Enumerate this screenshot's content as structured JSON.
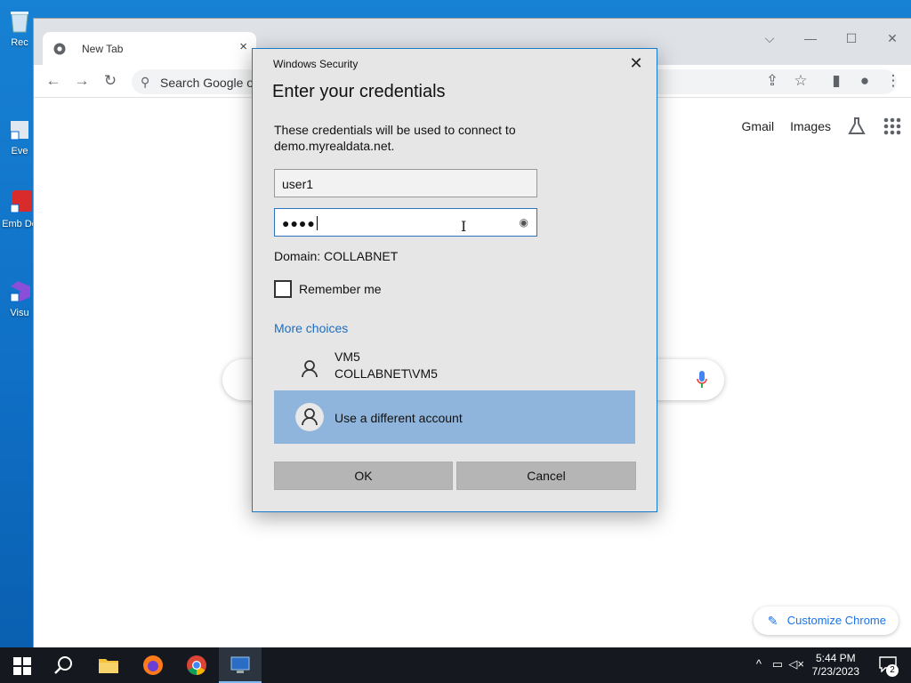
{
  "desktop": {
    "icons": [
      {
        "label": "Rec"
      },
      {
        "label": "Eve"
      },
      {
        "label": "Emb De"
      },
      {
        "label": "Visu"
      }
    ]
  },
  "browser": {
    "tab_title": "New Tab",
    "tab_close": "×",
    "omnibox_placeholder": "Search Google o",
    "ntp": {
      "gmail": "Gmail",
      "images": "Images",
      "customize": "Customize Chrome"
    }
  },
  "dialog": {
    "app_name": "Windows Security",
    "close": "✕",
    "title": "Enter your credentials",
    "message": "These credentials will be used to connect to demo.myrealdata.net.",
    "username_value": "user1",
    "password_mask": "●●●●",
    "domain": "Domain: COLLABNET",
    "remember_label": "Remember me",
    "more_choices": "More choices",
    "accounts": [
      {
        "name": "VM5",
        "detail": "COLLABNET\\VM5"
      },
      {
        "name": "Use a different account"
      }
    ],
    "ok_label": "OK",
    "cancel_label": "Cancel"
  },
  "taskbar": {
    "time": "5:44 PM",
    "date": "7/23/2023",
    "notifications_count": "2"
  },
  "colors": {
    "dialog_border": "#1979ca",
    "selected_account": "#8fb5dc",
    "link": "#1b6ec2",
    "taskbar": "#15191f"
  }
}
